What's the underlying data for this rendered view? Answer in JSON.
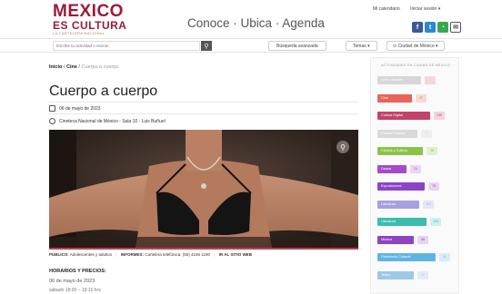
{
  "header": {
    "logo_line1": "MEXICO",
    "logo_line2": "ES CULTURA",
    "logo_line3": "LA CARTELERA NACIONAL",
    "tagline": "Conoce · Ubica · Agenda",
    "calendar_label": "Mi calendario",
    "login_label": "Iniciar sesión ▾",
    "social_icons": [
      "facebook-icon",
      "twitter-icon",
      "whatsapp-icon",
      "mail-icon"
    ]
  },
  "search": {
    "placeholder": "Escribe tu actividad o recinto",
    "advanced_label": "Búsqueda avanzada",
    "topics_label": "Temas ▾",
    "city_label": "Ciudad de México ▾"
  },
  "breadcrumb": {
    "home": "Inicio",
    "section": "Cine",
    "current": "Cuerpo a cuerpo"
  },
  "event": {
    "title": "Cuerpo a cuerpo",
    "date": "06 de mayo de 2023",
    "venue": "Cineteca Nacional de México - Sala 10 - Luis Buñuel",
    "public_label": "PÚBLICO:",
    "public_value": "Adolescentes y adultos",
    "info_label": "INFORMES:",
    "info_value": "Cartelera telefónica: (55) 4155 1190",
    "site_link": "IR AL SITIO WEB",
    "schedule_heading": "HORARIOS Y PRECIOS:",
    "schedule_date": "06 de mayo de 2023",
    "schedule_time": "sábado 18:00 – 19:10 hrs"
  },
  "sidebar": {
    "title": "ACTIVIDADES EN CIUDAD DE MÉXICO",
    "categories": [
      {
        "label": "Artes Visuales",
        "count": "45",
        "color": "#d7d7d7",
        "badge": "#f3d8dc"
      },
      {
        "label": "Cine",
        "count": "27",
        "color": "#e8635a",
        "badge": "#f9d7d5"
      },
      {
        "label": "Cultura Digital",
        "count": "139",
        "color": "#c2436a",
        "badge": "#f5d3dd"
      },
      {
        "label": "Cultura Popular",
        "count": "8",
        "color": "#d9d9d9",
        "badge": "#eeeeee"
      },
      {
        "label": "Ciencia y Cultura",
        "count": "38",
        "color": "#8bc34a",
        "badge": "#e2efd2"
      },
      {
        "label": "Danza",
        "count": "24",
        "color": "#a64ac9",
        "badge": "#ead6f2"
      },
      {
        "label": "Exposiciones",
        "count": "75",
        "color": "#8a45c6",
        "badge": "#e6d6f2"
      },
      {
        "label": "Literatura",
        "count": "112",
        "color": "#a6a0e0",
        "badge": "#e7e5f6"
      },
      {
        "label": "Literatura",
        "count": "128",
        "color": "#3bbcae",
        "badge": "#d2efeb"
      },
      {
        "label": "Música",
        "count": "88",
        "color": "#8e44c2",
        "badge": "#e5d4f1"
      },
      {
        "label": "Patrimonio Cultural",
        "count": "8",
        "color": "#5fb4e6",
        "badge": "#d7ecf8"
      },
      {
        "label": "Teatro",
        "count": "37",
        "color": "#9ec8e8",
        "badge": "#e2eef7"
      }
    ]
  }
}
